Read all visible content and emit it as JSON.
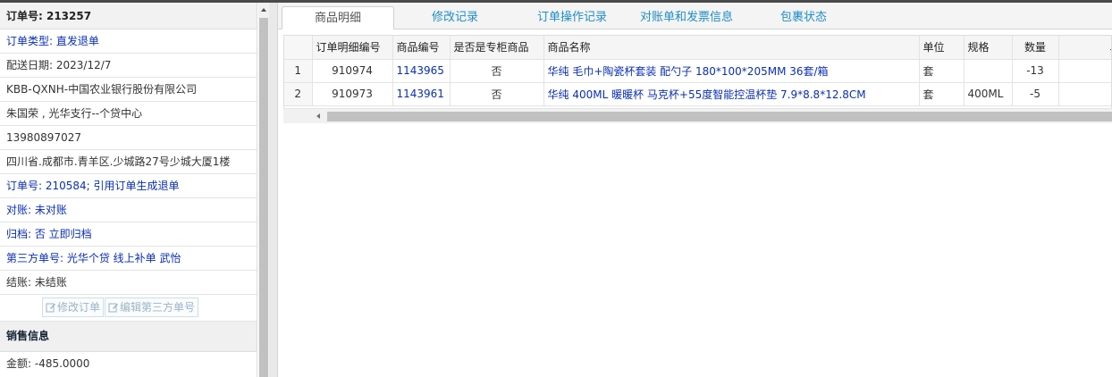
{
  "order": {
    "number_label": "订单号: 213257",
    "type": "订单类型: 直发退单",
    "delivery_date": "配送日期: 2023/12/7",
    "customer": "KBB-QXNH-中国农业银行股份有限公司",
    "contact": "朱国荣 , 光华支行--个贷中心",
    "phone": "13980897027",
    "address": "四川省.成都市.青羊区.少城路27号少城大厦1楼",
    "ref_order": "订单号: 210584; 引用订单生成退单",
    "reconcile": "对账: 未对账",
    "archive": "归档:  否 立即归档",
    "third_party": "第三方单号:  光华个贷 线上补单 武怡",
    "settle": "结账: 未结账",
    "buttons": {
      "edit_order": "修改订单",
      "edit_third": "编辑第三方单号"
    }
  },
  "sales": {
    "header": "销售信息",
    "amount": "金额: -485.0000"
  },
  "tabs": [
    {
      "label": "商品明细"
    },
    {
      "label": "修改记录"
    },
    {
      "label": "订单操作记录"
    },
    {
      "label": "对账单和发票信息"
    },
    {
      "label": "包裹状态"
    }
  ],
  "grid": {
    "columns": [
      "订单明细编号",
      "商品编号",
      "是否是专柜商品",
      "商品名称",
      "单位",
      "规格",
      "数量",
      "单"
    ],
    "rows": [
      {
        "rn": "1",
        "detail_id": "910974",
        "product_id": "1143965",
        "is_counter": "否",
        "name": "华纯 毛巾+陶瓷杯套装 配勺子 180*100*205MM 36套/箱",
        "unit": "套",
        "spec": "",
        "qty": "-13"
      },
      {
        "rn": "2",
        "detail_id": "910973",
        "product_id": "1143961",
        "is_counter": "否",
        "name": "华纯 400ML 暖暖杯 马克杯+55度智能控温杯垫 7.9*8.8*12.8CM",
        "unit": "套",
        "spec": "400ML",
        "qty": "-5"
      }
    ]
  },
  "colors": {
    "link": "#0a2fb3",
    "tab": "#1f8dc6"
  }
}
